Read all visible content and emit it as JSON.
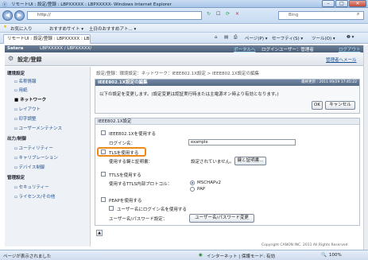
{
  "window": {
    "title": "リモートUI : 設定/登録 : LBPXXXXX : LBPXXXXX- Windows Internet Explorer"
  },
  "browser": {
    "address": "http://",
    "search_placeholder": "Bing",
    "favorites_label": "お気に入り",
    "fav_items": [
      "おすすめサイト ▾",
      "土日のおすすめアト... ▾"
    ],
    "tab_label": "リモートUI : 設定/登録 : LBPXXXXX : LBPXX...",
    "tools": [
      "ページ(P) ▾",
      "セーフティ(S) ▾",
      "ツール(O) ▾",
      "❷ ▾"
    ]
  },
  "app": {
    "brand": "Satera",
    "model": "LBPXXXXX / LBPXXXXX/",
    "portal_link": "ポータルへ",
    "login_user": "ログインユーザー：管理者",
    "logout_link": "ログアウト",
    "page_title": "設定/登録",
    "admin_mail": "管理者へメール"
  },
  "sidebar": {
    "sections": [
      {
        "title": "環境設定",
        "items": [
          "名称情報",
          "用紙",
          "ネットワーク",
          "レイアウト",
          "印字調整",
          "ユーザーメンテナンス"
        ]
      },
      {
        "title": "出力/制御",
        "items": [
          "ユーティリティー",
          "キャリブレーション",
          "デバイス制御"
        ]
      },
      {
        "title": "管理設定",
        "items": [
          "セキュリティー",
          "ライセンス/その他"
        ]
      }
    ],
    "selected": "ネットワーク"
  },
  "main": {
    "breadcrumb": "設定/登録：環境設定：ネットワーク：IEEE802.1X設定 > IEEE802.1X設定の編集",
    "panel_title": "IEEE802.1X設定の編集",
    "updated": "最終更新 : 2011 09/29 17:45:22",
    "instruction": "以下の設定を変更します。(設定変更は認証実行時または主電源オン時より有効となります。)",
    "ok_label": "OK",
    "cancel_label": "キャンセル",
    "section_title": "IEEE802.1X設定",
    "use_8021x_label": "IEEE802.1Xを使用する",
    "login_name_label": "ログイン名：",
    "login_name_value": "example",
    "use_tls_label": "TLSを使用する",
    "key_cert_label": "使用する鍵と証明書：",
    "key_cert_status": "設定されていません。",
    "key_cert_button": "鍵と証明書...",
    "use_ttls_label": "TTLSを使用する",
    "ttls_protocol_label": "使用するTTLS内部プロトコル：",
    "ttls_options": [
      "MSCHAPv2",
      "PAP"
    ],
    "ttls_selected": "MSCHAPv2",
    "use_peap_label": "PEAPを使用する",
    "same_as_login_label": "ユーザー名にログイン名を使用する",
    "user_pass_label": "ユーザー名/パスワード設定：",
    "user_pass_button": "ユーザー名/パスワード変更",
    "copyright": "Copyright CANON INC. 2011 All Rights Reserved"
  },
  "status": {
    "left": "ページが表示されました",
    "zone": "インターネット | 保護モード: 有効",
    "zoom": "100%"
  },
  "colors": {
    "highlight": "#ef8a1a",
    "appbar": "#566a86",
    "link": "#1c4f91"
  }
}
